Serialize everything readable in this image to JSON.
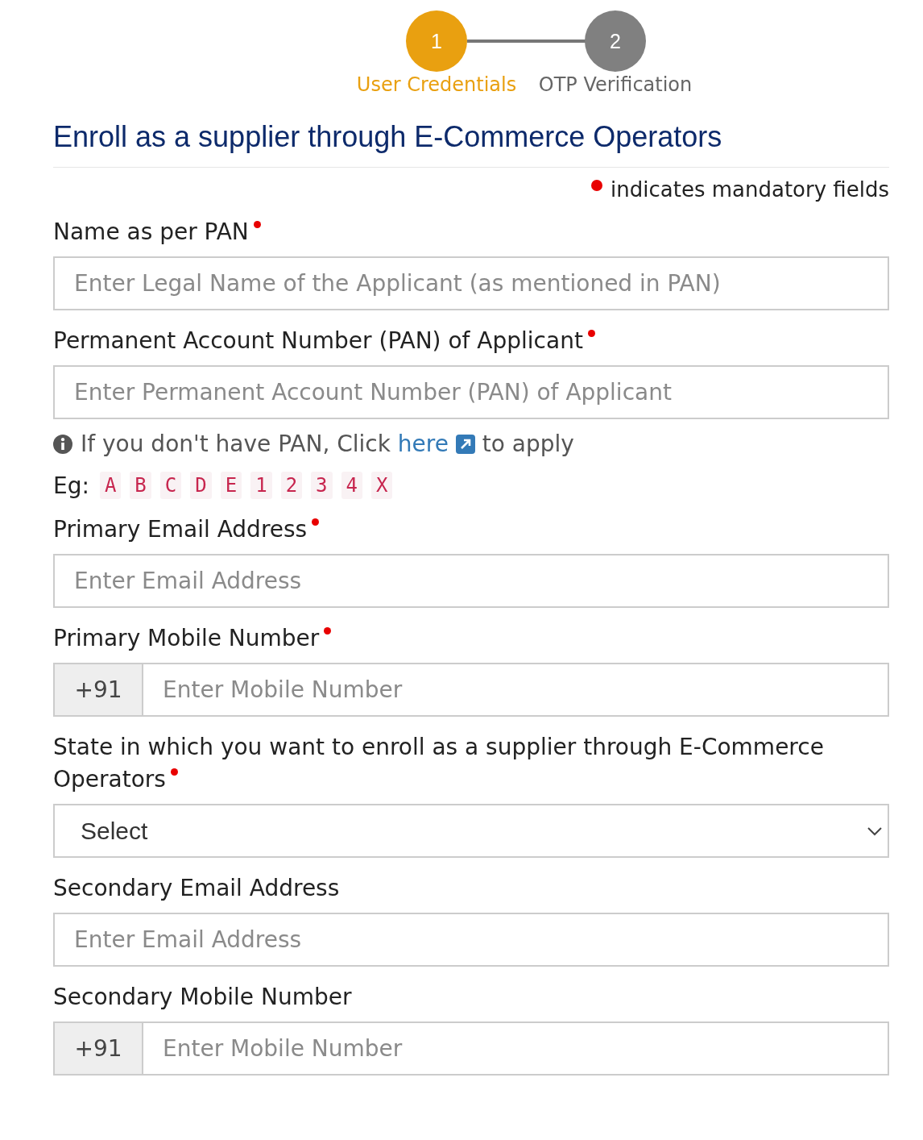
{
  "steps": [
    {
      "number": "1",
      "label": "User Credentials",
      "selected": true
    },
    {
      "number": "2",
      "label": "OTP Verification",
      "selected": false
    }
  ],
  "title": "Enroll as a supplier through E-Commerce Operators",
  "legend": "indicates mandatory fields",
  "fields": [
    {
      "kind": "text",
      "label": "Name as per PAN",
      "mandatory": true,
      "placeholder": "Enter Legal Name of the Applicant (as mentioned in PAN)"
    },
    {
      "kind": "text",
      "label": "Permanent Account Number (PAN) of Applicant",
      "mandatory": true,
      "placeholder": "Enter Permanent Account Number (PAN) of Applicant",
      "help": {
        "before": "If you don't have PAN, Click",
        "link": "here",
        "after": "to apply"
      },
      "example": {
        "label": "Eg:",
        "chars": [
          "A",
          "B",
          "C",
          "D",
          "E",
          "1",
          "2",
          "3",
          "4",
          "X"
        ]
      }
    },
    {
      "kind": "text",
      "label": "Primary Email Address",
      "mandatory": true,
      "placeholder": "Enter Email Address"
    },
    {
      "kind": "phone",
      "label": "Primary Mobile Number",
      "mandatory": true,
      "prefix": "+91",
      "placeholder": "Enter Mobile Number"
    },
    {
      "kind": "select",
      "label": "State in which you want to enroll as a supplier through E-Commerce Operators",
      "mandatory": true,
      "value": "Select"
    },
    {
      "kind": "text",
      "label": "Secondary Email Address",
      "mandatory": false,
      "placeholder": "Enter Email Address"
    },
    {
      "kind": "phone",
      "label": "Secondary Mobile Number",
      "mandatory": false,
      "prefix": "+91",
      "placeholder": "Enter Mobile Number"
    }
  ]
}
